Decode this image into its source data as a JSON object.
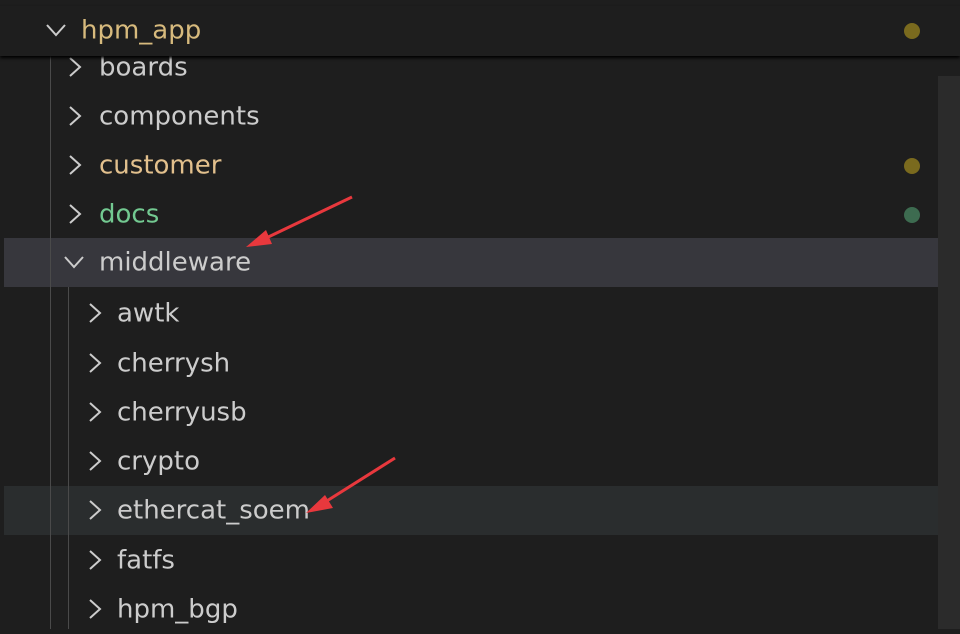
{
  "explorer": {
    "root": {
      "label": "hpm_app",
      "expanded": true,
      "status_dot": "#8a7a2a"
    },
    "items": [
      {
        "label": "boards",
        "expanded": false,
        "color": "#cccccc"
      },
      {
        "label": "components",
        "expanded": false,
        "color": "#cccccc"
      },
      {
        "label": "customer",
        "expanded": false,
        "color": "#e2c08d",
        "status_dot": "#8a7a2a"
      },
      {
        "label": "docs",
        "expanded": false,
        "color": "#73c991",
        "status_dot": "#3d6b50"
      },
      {
        "label": "middleware",
        "expanded": true,
        "selected": true,
        "color": "#cccccc"
      }
    ],
    "children": [
      {
        "label": "awtk"
      },
      {
        "label": "cherrysh"
      },
      {
        "label": "cherryusb"
      },
      {
        "label": "crypto"
      },
      {
        "label": "ethercat_soem",
        "hovered": true
      },
      {
        "label": "fatfs"
      },
      {
        "label": "hpm_bgp"
      }
    ]
  },
  "annotations": {
    "arrow_color": "#e8383d"
  }
}
